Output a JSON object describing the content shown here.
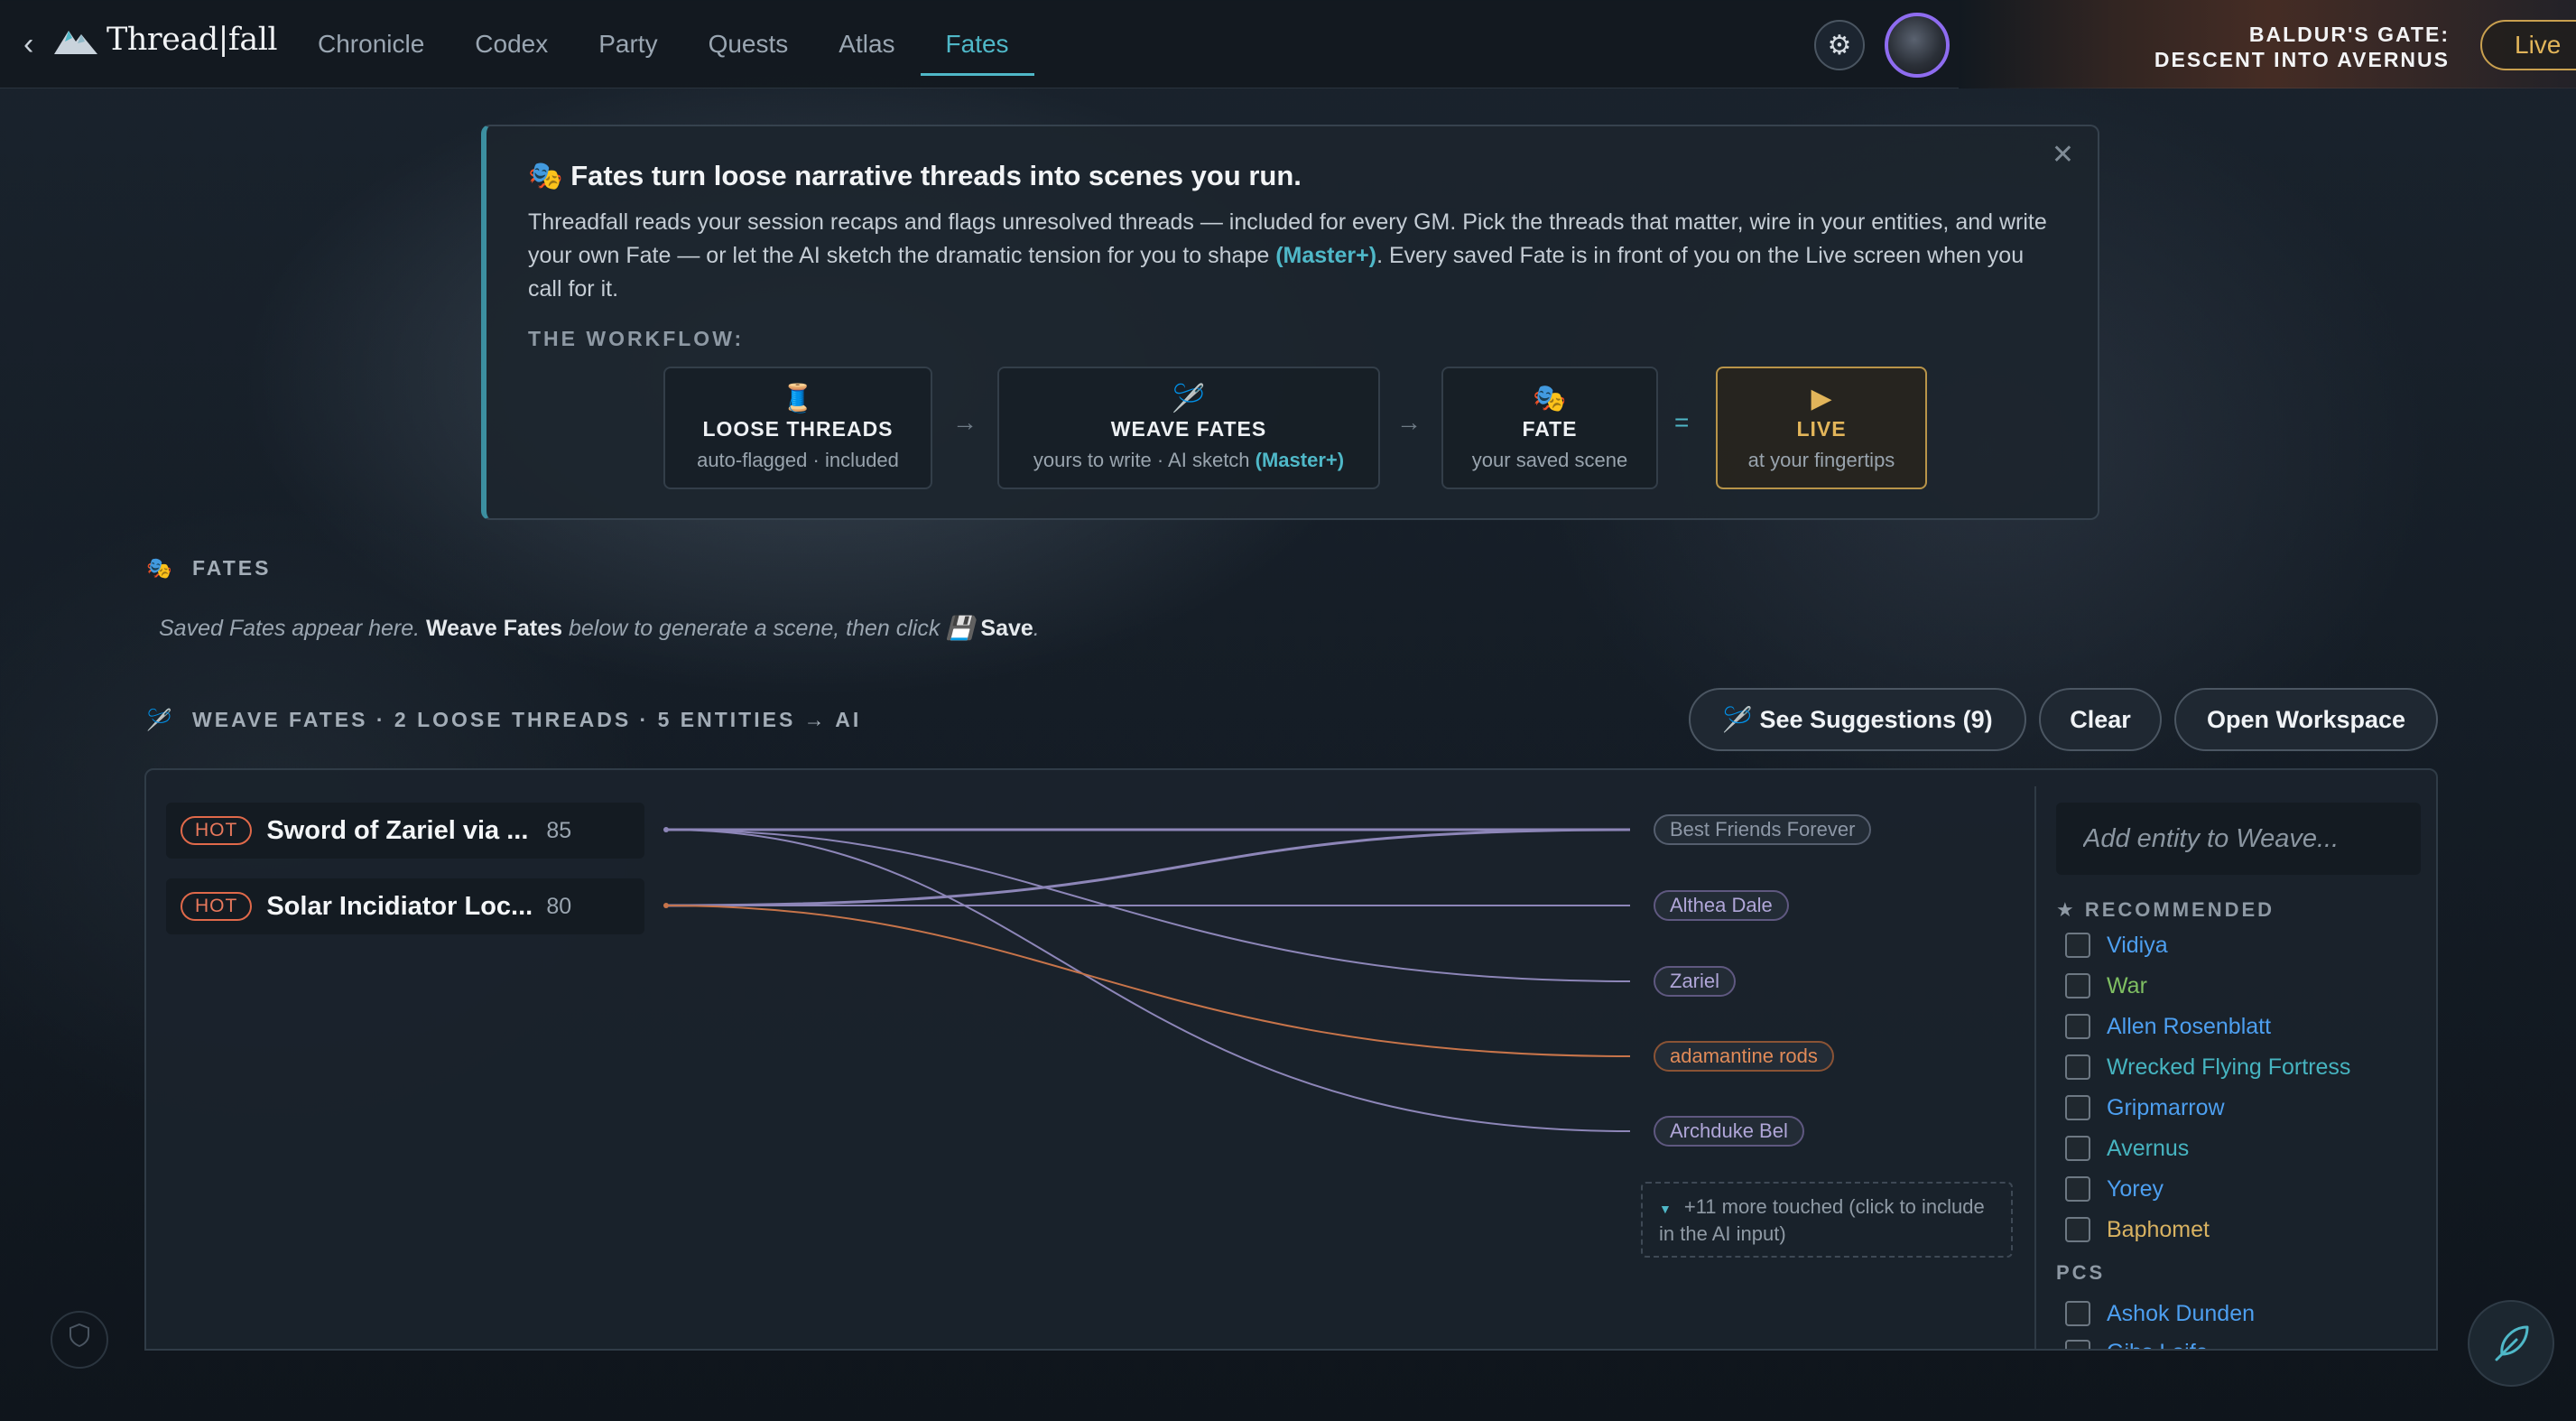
{
  "nav": {
    "back_icon": "chevron-left-icon",
    "back_glyph": "‹",
    "logo_text": "Thread|fall",
    "items": [
      {
        "label": "Chronicle",
        "active": false
      },
      {
        "label": "Codex",
        "active": false
      },
      {
        "label": "Party",
        "active": false
      },
      {
        "label": "Quests",
        "active": false
      },
      {
        "label": "Atlas",
        "active": false
      },
      {
        "label": "Fates",
        "active": true
      }
    ],
    "settings_glyph": "⚙",
    "campaign_line1": "BALDUR'S GATE:",
    "campaign_line2": "DESCENT INTO AVERNUS",
    "live_label": "Live"
  },
  "intro": {
    "title_icon": "🎭",
    "title": "Fates turn loose narrative threads into scenes you run.",
    "close_glyph": "✕",
    "body_1": "Threadfall reads your session recaps and flags unresolved threads — included for every GM. Pick the threads that matter, wire in your entities, and write your own Fate — or let the AI sketch the dramatic tension for you to shape ",
    "body_master": "(Master+)",
    "body_2": ". Every saved Fate is in front of you on the Live screen when you call for it.",
    "workflow_label": "THE WORKFLOW:",
    "steps": [
      {
        "icon": "🧵",
        "title": "LOOSE THREADS",
        "sub": "auto-flagged · included",
        "sub_extra": ""
      },
      {
        "icon": "🪡",
        "title": "WEAVE FATES",
        "sub": "yours to write · AI sketch ",
        "sub_extra": "(Master+)"
      },
      {
        "icon": "🎭",
        "title": "FATE",
        "sub": "your saved scene",
        "sub_extra": ""
      },
      {
        "icon": "▶",
        "title": "LIVE",
        "sub": "at your fingertips",
        "sub_extra": ""
      }
    ],
    "arrow": "→",
    "equals": "="
  },
  "fates": {
    "icon": "🎭",
    "heading": "FATES",
    "empty_1": "Saved Fates appear here. ",
    "empty_weave": "Weave Fates",
    "empty_2": " below to generate a scene, then click ",
    "empty_save_icon": "💾",
    "empty_save": "Save",
    "empty_3": "."
  },
  "weave": {
    "icon": "🪡",
    "heading": "WEAVE FATES · 2 LOOSE THREADS · 5 ENTITIES → AI",
    "suggest_label": "See Suggestions (9)",
    "suggest_icon": "🪡",
    "clear_label": "Clear",
    "workspace_label": "Open Workspace",
    "threads": [
      {
        "tag": "HOT",
        "name": "Sword of Zariel via ...",
        "score": "85"
      },
      {
        "tag": "HOT",
        "name": "Solar Incidiator Loc...",
        "score": "80"
      }
    ],
    "entities": [
      {
        "name": "Best Friends Forever",
        "tone": "gray"
      },
      {
        "name": "Althea Dale",
        "tone": "purple"
      },
      {
        "name": "Zariel",
        "tone": "purple"
      },
      {
        "name": "adamantine rods",
        "tone": "orange"
      },
      {
        "name": "Archduke Bel",
        "tone": "purple"
      }
    ],
    "more_glyph": "▼",
    "more_text": "+11 more touched (click to include in the AI input)",
    "colors": {
      "purple_wire": "#8d86b8",
      "orange_wire": "#c7744a"
    }
  },
  "sidebar": {
    "search_placeholder": "Add entity to Weave...",
    "recommended_heading": "★ RECOMMENDED",
    "recommended": [
      {
        "name": "Vidiya",
        "color": "blue"
      },
      {
        "name": "War",
        "color": "green"
      },
      {
        "name": "Allen Rosenblatt",
        "color": "blue"
      },
      {
        "name": "Wrecked Flying Fortress",
        "color": "teal"
      },
      {
        "name": "Gripmarrow",
        "color": "blue"
      },
      {
        "name": "Avernus",
        "color": "teal"
      },
      {
        "name": "Yorey",
        "color": "blue"
      },
      {
        "name": "Baphomet",
        "color": "gold"
      }
    ],
    "pcs_heading": "PCS",
    "pcs": [
      {
        "name": "Ashok Dunden",
        "color": "blue"
      },
      {
        "name": "Gibs Loife",
        "color": "blue"
      }
    ]
  },
  "footer": {
    "shield_icon": "shield-icon",
    "feather_icon": "feather-icon"
  }
}
